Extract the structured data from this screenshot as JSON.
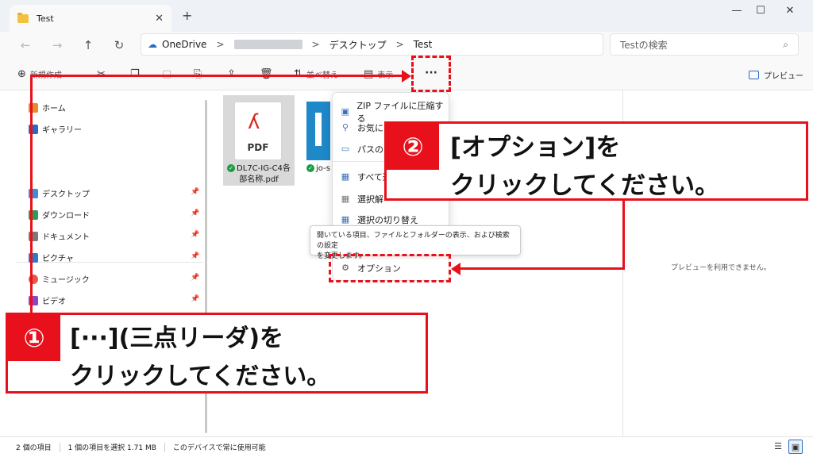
{
  "window": {
    "tab_title": "Test",
    "new_tab": "+",
    "minimize": "—",
    "maximize": "☐",
    "close": "✕"
  },
  "nav": {
    "back": "←",
    "forward": "→",
    "up": "↑",
    "refresh": "↻"
  },
  "address": {
    "crumbs": [
      "OneDrive",
      "デスクトップ",
      "Test"
    ],
    "separator": ">"
  },
  "search": {
    "placeholder": "Testの検索",
    "icon": "search-icon"
  },
  "toolbar": {
    "new_label": "新規作成",
    "sort_label": "並べ替え",
    "view_label": "表示",
    "more_label": "···",
    "preview_label": "プレビュー"
  },
  "sidebar": {
    "items": [
      {
        "label": "ホーム",
        "icon": "home-icon",
        "color": "#e88a2e"
      },
      {
        "label": "ギャラリー",
        "icon": "gallery-icon",
        "color": "#2a6ac4"
      },
      {
        "label": "デスクトップ",
        "icon": "desktop-icon",
        "color": "#3b8de0"
      },
      {
        "label": "ダウンロード",
        "icon": "download-icon",
        "color": "#2e9a5c"
      },
      {
        "label": "ドキュメント",
        "icon": "documents-icon",
        "color": "#7a7a7a"
      },
      {
        "label": "ピクチャ",
        "icon": "pictures-icon",
        "color": "#2f79c9"
      },
      {
        "label": "ミュージック",
        "icon": "music-icon",
        "color": "#e4574c"
      },
      {
        "label": "ビデオ",
        "icon": "video-icon",
        "color": "#8e44c7"
      }
    ]
  },
  "files": [
    {
      "name_line1": "DL7C-IG-C4各",
      "name_line2": "部名称.pdf",
      "type_label": "PDF"
    },
    {
      "name_line1": "jo-s"
    }
  ],
  "menu": {
    "items": [
      {
        "label": "ZIP ファイルに圧縮する",
        "icon": "zip-icon"
      },
      {
        "label": "お気に",
        "icon": "pin-icon"
      },
      {
        "label": "パスのコ",
        "icon": "copy-path-icon"
      },
      {
        "label": "すべて選",
        "icon": "select-all-icon"
      },
      {
        "label": "選択解",
        "icon": "select-none-icon"
      },
      {
        "label": "選択の切り替え",
        "icon": "invert-selection-icon"
      }
    ],
    "options_label": "オプション"
  },
  "tooltip": {
    "line1": "開いている項目、ファイルとフォルダーの表示、および検索の設定",
    "line2": "を変更します。"
  },
  "preview": {
    "message": "プレビューを利用できません。"
  },
  "status": {
    "count": "2 個の項目",
    "selected": "1 個の項目を選択  1.71 MB",
    "availability": "このデバイスで常に使用可能"
  },
  "callouts": {
    "one_num": "①",
    "one_line1": "[···](三点リーダ)を",
    "one_line2": "クリックしてください。",
    "two_num": "②",
    "two_line1": "[オプション]を",
    "two_line2": "クリックしてください。"
  },
  "colors": {
    "accent": "#e8111b",
    "link": "#2a6ac4"
  }
}
